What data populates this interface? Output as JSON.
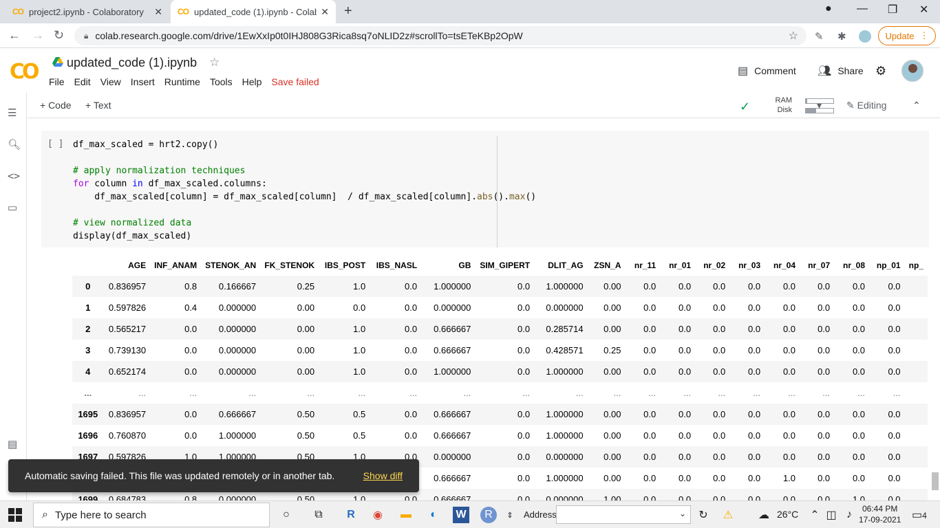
{
  "browser": {
    "tabs": [
      {
        "favicon": "CO",
        "title": "project2.ipynb - Colaboratory"
      },
      {
        "favicon": "CO",
        "title": "updated_code (1).ipynb - Colabo"
      }
    ],
    "url": "colab.research.google.com/drive/1EwXxIp0t0IHJ808G3Rica8sq7oNLID2z#scrollTo=tsETeKBp2OpW",
    "update_label": "Update"
  },
  "colab": {
    "logo": "CO",
    "title": "updated_code (1).ipynb",
    "menu": [
      "File",
      "Edit",
      "View",
      "Insert",
      "Runtime",
      "Tools",
      "Help"
    ],
    "save_status": "Save failed",
    "comment_label": "Comment",
    "share_label": "Share",
    "add_code_label": "+ Code",
    "add_text_label": "+ Text",
    "ram_label": "RAM",
    "disk_label": "Disk",
    "ram_fraction": 0.05,
    "disk_fraction": 0.38,
    "editing_label": "Editing"
  },
  "cell": {
    "run_indicator": "[ ]",
    "code_lines": [
      "df_max_scaled = hrt2.copy()",
      "",
      "# apply normalization techniques",
      "for column in df_max_scaled.columns:",
      "    df_max_scaled[column] = df_max_scaled[column]  / df_max_scaled[column].abs().max()",
      "",
      "# view normalized data",
      "display(df_max_scaled)"
    ]
  },
  "output": {
    "columns": [
      "",
      "AGE",
      "INF_ANAM",
      "STENOK_AN",
      "FK_STENOK",
      "IBS_POST",
      "IBS_NASL",
      "GB",
      "SIM_GIPERT",
      "DLIT_AG",
      "ZSN_A",
      "nr_11",
      "nr_01",
      "nr_02",
      "nr_03",
      "nr_04",
      "nr_07",
      "nr_08",
      "np_01",
      "np_"
    ],
    "rows": [
      [
        "0",
        "0.836957",
        "0.8",
        "0.166667",
        "0.25",
        "1.0",
        "0.0",
        "1.000000",
        "0.0",
        "1.000000",
        "0.00",
        "0.0",
        "0.0",
        "0.0",
        "0.0",
        "0.0",
        "0.0",
        "0.0",
        "0.0",
        ""
      ],
      [
        "1",
        "0.597826",
        "0.4",
        "0.000000",
        "0.00",
        "0.0",
        "0.0",
        "0.000000",
        "0.0",
        "0.000000",
        "0.00",
        "0.0",
        "0.0",
        "0.0",
        "0.0",
        "0.0",
        "0.0",
        "0.0",
        "0.0",
        ""
      ],
      [
        "2",
        "0.565217",
        "0.0",
        "0.000000",
        "0.00",
        "1.0",
        "0.0",
        "0.666667",
        "0.0",
        "0.285714",
        "0.00",
        "0.0",
        "0.0",
        "0.0",
        "0.0",
        "0.0",
        "0.0",
        "0.0",
        "0.0",
        ""
      ],
      [
        "3",
        "0.739130",
        "0.0",
        "0.000000",
        "0.00",
        "1.0",
        "0.0",
        "0.666667",
        "0.0",
        "0.428571",
        "0.25",
        "0.0",
        "0.0",
        "0.0",
        "0.0",
        "0.0",
        "0.0",
        "0.0",
        "0.0",
        ""
      ],
      [
        "4",
        "0.652174",
        "0.0",
        "0.000000",
        "0.00",
        "1.0",
        "0.0",
        "1.000000",
        "0.0",
        "1.000000",
        "0.00",
        "0.0",
        "0.0",
        "0.0",
        "0.0",
        "0.0",
        "0.0",
        "0.0",
        "0.0",
        ""
      ],
      [
        "...",
        "...",
        "...",
        "...",
        "...",
        "...",
        "...",
        "...",
        "...",
        "...",
        "...",
        "...",
        "...",
        "...",
        "...",
        "...",
        "...",
        "...",
        "...",
        ""
      ],
      [
        "1695",
        "0.836957",
        "0.0",
        "0.666667",
        "0.50",
        "0.5",
        "0.0",
        "0.666667",
        "0.0",
        "1.000000",
        "0.00",
        "0.0",
        "0.0",
        "0.0",
        "0.0",
        "0.0",
        "0.0",
        "0.0",
        "0.0",
        ""
      ],
      [
        "1696",
        "0.760870",
        "0.0",
        "1.000000",
        "0.50",
        "0.5",
        "0.0",
        "0.666667",
        "0.0",
        "1.000000",
        "0.00",
        "0.0",
        "0.0",
        "0.0",
        "0.0",
        "0.0",
        "0.0",
        "0.0",
        "0.0",
        ""
      ],
      [
        "1697",
        "0.597826",
        "1.0",
        "1.000000",
        "0.50",
        "1.0",
        "0.0",
        "0.000000",
        "0.0",
        "0.000000",
        "0.00",
        "0.0",
        "0.0",
        "0.0",
        "0.0",
        "0.0",
        "0.0",
        "0.0",
        "0.0",
        ""
      ],
      [
        "1698",
        "",
        "",
        "",
        "",
        "",
        "",
        "0.666667",
        "0.0",
        "1.000000",
        "0.00",
        "0.0",
        "0.0",
        "0.0",
        "0.0",
        "1.0",
        "0.0",
        "0.0",
        "0.0",
        ""
      ],
      [
        "1699",
        "0.684783",
        "0.8",
        "0.000000",
        "0.50",
        "1.0",
        "0.0",
        "0.666667",
        "0.0",
        "0.000000",
        "1.00",
        "0.0",
        "0.0",
        "0.0",
        "0.0",
        "0.0",
        "0.0",
        "1.0",
        "0.0",
        ""
      ]
    ]
  },
  "snackbar": {
    "message": "Automatic saving failed. This file was updated remotely or in another tab.",
    "action": "Show diff"
  },
  "taskbar": {
    "search_placeholder": "Type here to search",
    "address_label": "Address",
    "temperature": "26°C",
    "time": "06:44 PM",
    "date": "17-09-2021",
    "notifications": "4"
  }
}
